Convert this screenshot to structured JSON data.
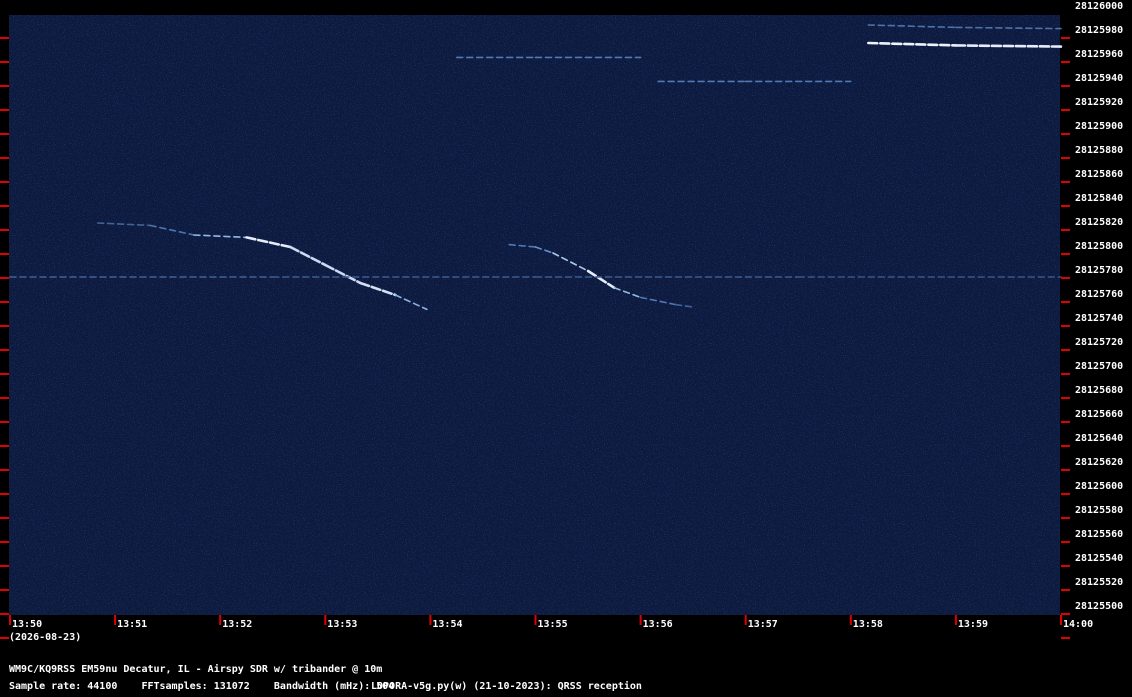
{
  "chart_data": {
    "type": "heatmap",
    "title": "",
    "xlabel": "",
    "ylabel": "",
    "x_ticks": [
      "13:50",
      "13:51",
      "13:52",
      "13:53",
      "13:54",
      "13:55",
      "13:56",
      "13:57",
      "13:58",
      "13:59",
      "14:00"
    ],
    "date_label": "(2026-08-23)",
    "x_range": [
      "13:50",
      "14:00"
    ],
    "y_ticks": [
      28126000,
      28125980,
      28125960,
      28125940,
      28125920,
      28125900,
      28125880,
      28125860,
      28125840,
      28125820,
      28125800,
      28125780,
      28125760,
      28125740,
      28125720,
      28125700,
      28125680,
      28125660,
      28125640,
      28125620,
      28125600,
      28125580,
      28125560,
      28125540,
      28125520,
      28125500
    ],
    "y_range": [
      28125500,
      28126000
    ],
    "grid": false,
    "colormap": [
      "#0b1a3e",
      "#6fa0e0",
      "#ffffff"
    ],
    "traces": [
      {
        "x": [
          "13:50:50",
          "13:51:20",
          "13:51:45",
          "13:52:15",
          "13:52:40",
          "13:53:00",
          "13:53:20",
          "13:53:40",
          "13:53:58"
        ],
        "y": [
          28125820,
          28125818,
          28125810,
          28125808,
          28125800,
          28125785,
          28125770,
          28125760,
          28125748
        ],
        "intensity": [
          0.3,
          0.35,
          0.45,
          0.95,
          0.9,
          0.8,
          0.9,
          0.85,
          0.5
        ]
      },
      {
        "x": [
          "13:54:45",
          "13:55:00",
          "13:55:10",
          "13:55:30",
          "13:55:45",
          "13:56:00",
          "13:56:20",
          "13:56:30"
        ],
        "y": [
          28125802,
          28125800,
          28125795,
          28125780,
          28125766,
          28125758,
          28125752,
          28125750
        ],
        "intensity": [
          0.4,
          0.45,
          0.6,
          0.95,
          0.9,
          0.5,
          0.35,
          0.3
        ]
      },
      {
        "x": [
          "13:50:00",
          "13:52:30",
          "13:55:00",
          "13:57:30",
          "14:00:00"
        ],
        "y": [
          28125775,
          28125775,
          28125775,
          28125775,
          28125775
        ],
        "intensity": [
          0.35,
          0.3,
          0.3,
          0.3,
          0.25
        ]
      },
      {
        "x": [
          "13:58:10",
          "13:59:00",
          "14:00:00"
        ],
        "y": [
          28125970,
          28125968,
          28125967
        ],
        "intensity": [
          0.95,
          0.95,
          0.9
        ]
      },
      {
        "x": [
          "13:58:10",
          "13:59:00",
          "14:00:00"
        ],
        "y": [
          28125985,
          28125983,
          28125982
        ],
        "intensity": [
          0.4,
          0.4,
          0.4
        ]
      },
      {
        "x": [
          "13:54:15",
          "13:55:00",
          "13:56:00"
        ],
        "y": [
          28125958,
          28125958,
          28125958
        ],
        "intensity": [
          0.4,
          0.45,
          0.4
        ]
      },
      {
        "x": [
          "13:56:10",
          "13:57:00",
          "13:58:00"
        ],
        "y": [
          28125938,
          28125938,
          28125938
        ],
        "intensity": [
          0.4,
          0.45,
          0.4
        ]
      }
    ]
  },
  "footer": {
    "station": "WM9C/KQ9RSS EM59nu Decatur, IL - Airspy SDR w/ tribander @ 10m",
    "params": "Sample rate: 44100    FFTsamples: 131072    Bandwidth (mHz): 504",
    "software": "LOPORA-v5g.py(w) (21-10-2023): QRSS reception"
  }
}
